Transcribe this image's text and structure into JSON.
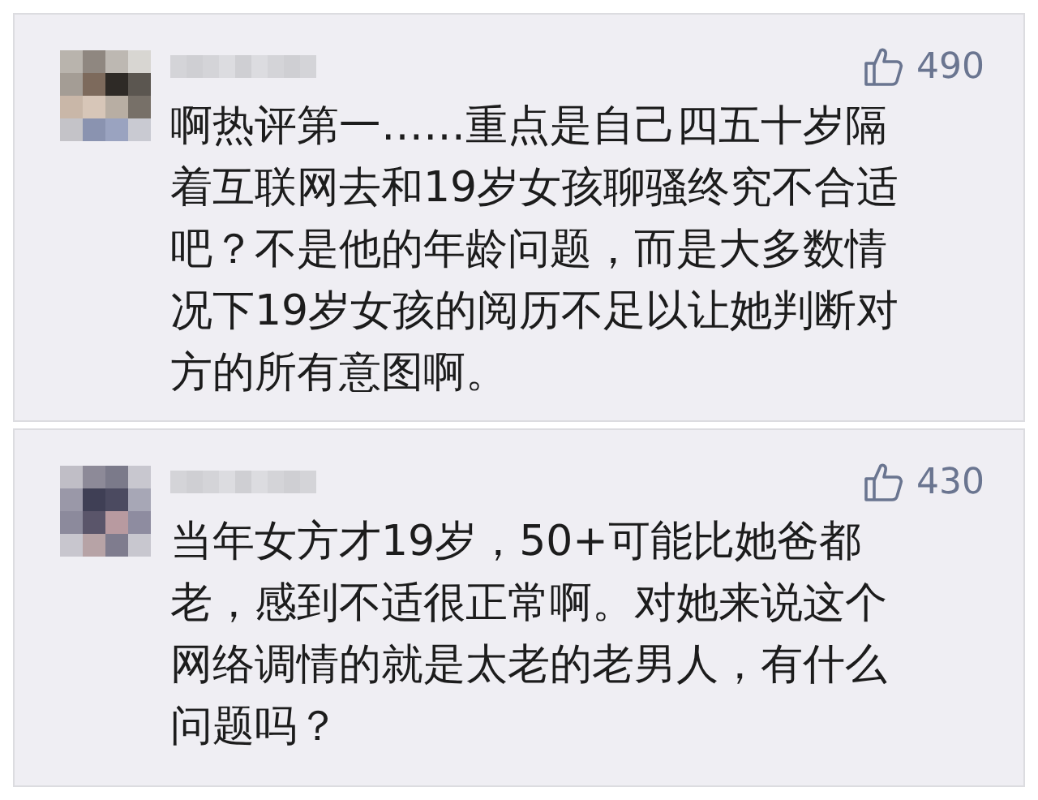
{
  "comments": [
    {
      "likes": "490",
      "text": "啊热评第一……重点是自己四五十岁隔着互联网去和19岁女孩聊骚终究不合适吧？不是他的年龄问题，而是大多数情况下19岁女孩的阅历不足以让她判断对方的所有意图啊。"
    },
    {
      "likes": "430",
      "text": "当年女方才19岁，50+可能比她爸都老，感到不适很正常啊。对她来说这个网络调情的就是太老的老男人，有什么问题吗？"
    }
  ]
}
